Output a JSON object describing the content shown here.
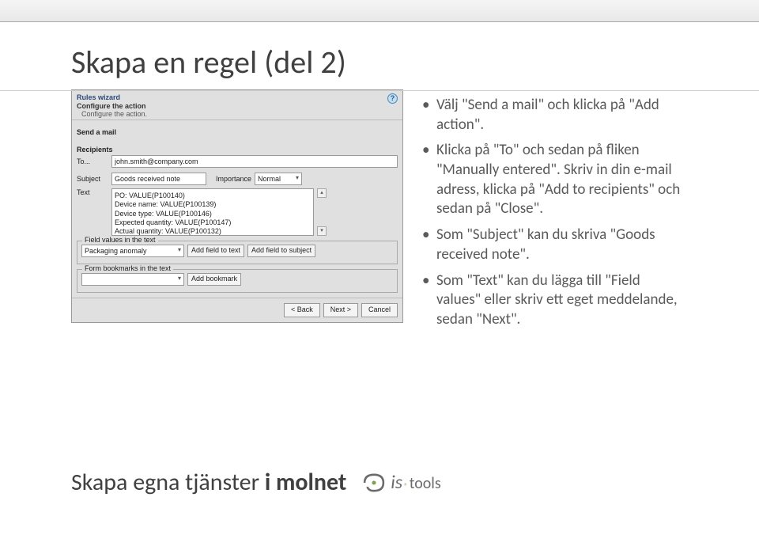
{
  "pageTitle": "Skapa en regel (del 2)",
  "wizard": {
    "title": "Rules wizard",
    "sub1": "Configure the action",
    "sub2": "Configure the action.",
    "sectionTitle": "Send a mail",
    "recipientsLabel": "Recipients",
    "toLabel": "To...",
    "toValue": "john.smith@company.com",
    "subjectLabel": "Subject",
    "subjectValue": "Goods received note",
    "importanceLabel": "Importance",
    "importanceValue": "Normal",
    "textLabel": "Text",
    "textValue": "PO: VALUE(P100140)\nDevice name: VALUE(P100139)\nDevice type: VALUE(P100146)\nExpected quantity: VALUE(P100147)\nActual quantity: VALUE(P100132)",
    "fieldsetFV": "Field values in the text",
    "fvSelect": "Packaging anomaly",
    "addFieldText": "Add field to text",
    "addFieldSubject": "Add field to subject",
    "fieldsetFB": "Form bookmarks in the text",
    "addBookmark": "Add bookmark",
    "back": "< Back",
    "next": "Next >",
    "cancel": "Cancel"
  },
  "bullets": [
    "Välj \"Send a mail\" och klicka på \"Add action\".",
    "Klicka på \"To\" och sedan på fliken \"Manually entered\". Skriv in din e-mail adress, klicka på \"Add to recipients\" och sedan på \"Close\".",
    "Som \"Subject\" kan du skriva \"Goods received note\".",
    "Som \"Text\" kan du lägga till \"Field values\" eller skriv ett eget meddelande, sedan \"Next\"."
  ],
  "footer": {
    "part1": "Skapa egna tjänster ",
    "part2": "i molnet",
    "logoIs": "is",
    "logoTools": "tools"
  }
}
